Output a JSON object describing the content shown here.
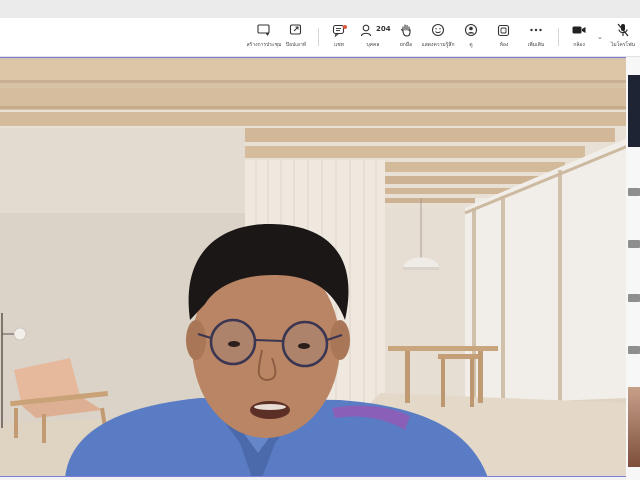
{
  "toolbar": {
    "items": [
      {
        "label": "สร้างการประชุม",
        "icon": "new-meeting-icon"
      },
      {
        "label": "ป๊อปเอาท์",
        "icon": "popout-icon"
      },
      {
        "label": "แชท",
        "icon": "chat-icon"
      },
      {
        "label": "บุคคล",
        "icon": "people-icon",
        "count": "204"
      },
      {
        "label": "ยกมือ",
        "icon": "raise-hand-icon"
      },
      {
        "label": "แสดงความรู้สึก",
        "icon": "react-icon"
      },
      {
        "label": "ดู",
        "icon": "view-icon"
      },
      {
        "label": "ห้อง",
        "icon": "rooms-icon"
      },
      {
        "label": "เพิ่มเติม",
        "icon": "more-icon"
      },
      {
        "label": "กล้อง",
        "icon": "camera-icon"
      },
      {
        "label": "ไมโครโฟน",
        "icon": "mic-off-icon"
      }
    ]
  },
  "colors": {
    "stage_border": "#7b7fd9",
    "notification_dot": "#e05a3c",
    "shirt": "#5a7cc4"
  }
}
